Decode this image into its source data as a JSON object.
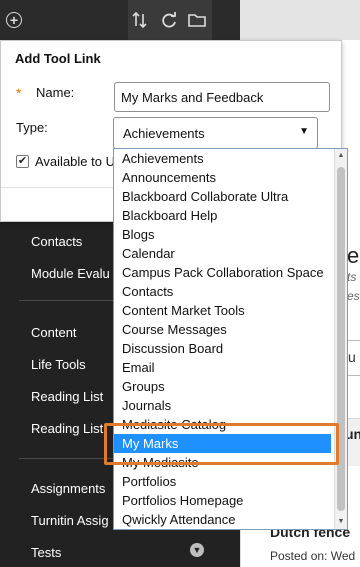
{
  "toolbar": {
    "icons": [
      "plus-circle-icon",
      "sort-icon",
      "refresh-icon",
      "folder-icon"
    ]
  },
  "panel": {
    "title": "Add Tool Link",
    "required_marker": "*",
    "name_label": "Name:",
    "name_value": "My Marks and Feedback",
    "type_label": "Type:",
    "type_value": "Achievements",
    "available_label": "Available to U",
    "available_checked": true
  },
  "dropdown": {
    "options": [
      "Achievements",
      "Announcements",
      "Blackboard Collaborate Ultra",
      "Blackboard Help",
      "Blogs",
      "Calendar",
      "Campus Pack Collaboration Space",
      "Contacts",
      "Content Market Tools",
      "Course Messages",
      "Discussion Board",
      "Email",
      "Groups",
      "Journals",
      "Mediasite Catalog",
      "My Marks",
      "My Mediasite",
      "Portfolios",
      "Portfolios Homepage",
      "Qwickly Attendance"
    ],
    "selected": "My Marks",
    "highlight_color": "#e07b2d",
    "selected_color": "#1e90ff"
  },
  "nav": {
    "items": [
      "Contacts",
      "Module Evalu",
      "Content",
      "Life Tools",
      "Reading List",
      "Reading List",
      "Assignments",
      "Turnitin Assig",
      "Tests"
    ]
  },
  "content": {
    "frag_e": "e",
    "frag_ts": "ts",
    "frag_es": "es",
    "frag_u": "u",
    "frag_un": "un",
    "heading": "Dutch fence",
    "posted": "Posted on: Wed"
  }
}
